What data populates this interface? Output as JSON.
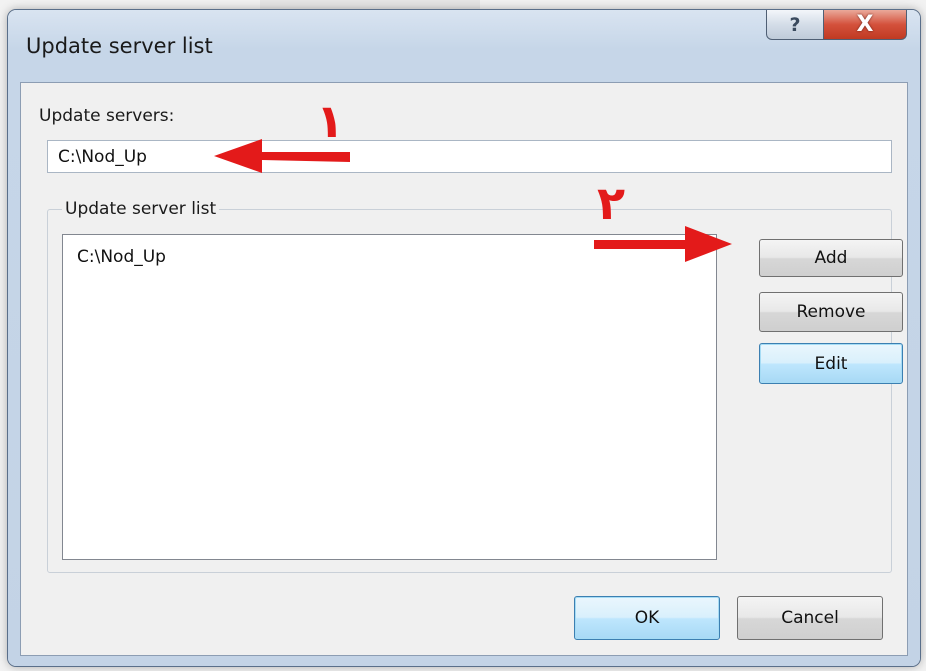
{
  "dialog": {
    "title": "Update server list",
    "help_label": "?",
    "close_label": "X"
  },
  "servers": {
    "label": "Update servers:",
    "input_value": "C:\\Nod_Up"
  },
  "server_list": {
    "legend": "Update server list",
    "items": [
      "C:\\Nod_Up"
    ]
  },
  "buttons": {
    "add": "Add",
    "remove": "Remove",
    "edit": "Edit",
    "ok": "OK",
    "cancel": "Cancel"
  },
  "annotations": {
    "marker_1": "١",
    "marker_2": "٢",
    "color": "#e31a1a"
  }
}
